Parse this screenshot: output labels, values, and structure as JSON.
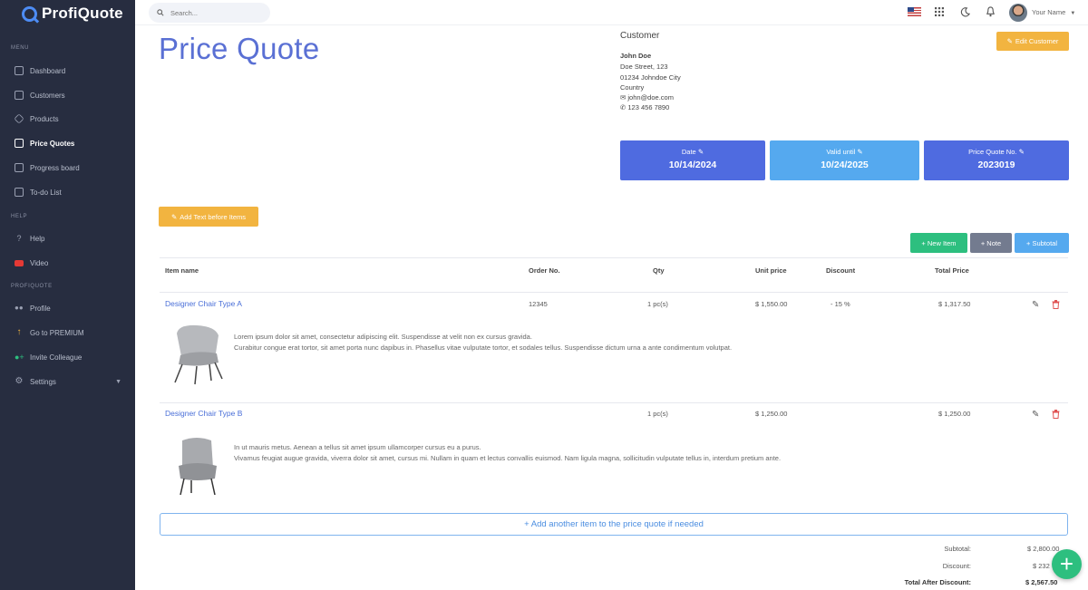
{
  "app": {
    "brand": "ProfiQuote"
  },
  "sidebar": {
    "headings": {
      "menu": "MENU",
      "help": "HELP",
      "profiquote": "PROFIQUOTE"
    },
    "items": [
      {
        "label": "Dashboard",
        "icon": "dashboard-icon"
      },
      {
        "label": "Customers",
        "icon": "customers-icon"
      },
      {
        "label": "Products",
        "icon": "products-icon"
      },
      {
        "label": "Price Quotes",
        "icon": "price-quotes-icon",
        "active": true
      },
      {
        "label": "Progress board",
        "icon": "progress-board-icon"
      },
      {
        "label": "To-do List",
        "icon": "todo-icon"
      },
      {
        "label": "Help",
        "icon": "help-icon"
      },
      {
        "label": "Video",
        "icon": "video-icon"
      },
      {
        "label": "Profile",
        "icon": "profile-icon"
      },
      {
        "label": "Go to PREMIUM",
        "icon": "arrow-up-icon"
      },
      {
        "label": "Invite Colleague",
        "icon": "add-user-icon"
      },
      {
        "label": "Settings",
        "icon": "settings-icon"
      }
    ]
  },
  "topbar": {
    "search_placeholder": "Search...",
    "username": "Your Name"
  },
  "quote": {
    "title": "Price Quote",
    "customer": {
      "heading": "Customer",
      "name": "John Doe",
      "street": "Doe Street, 123",
      "city": "01234 Johndoe City",
      "country": "Country",
      "email": "john@doe.com",
      "phone": "123 456 7890",
      "edit_label": "Edit Customer"
    },
    "date": {
      "label": "Date",
      "value": "10/14/2024"
    },
    "valid_until": {
      "label": "Valid until",
      "value": "10/24/2025"
    },
    "number": {
      "label": "Price Quote No.",
      "value": "2023019"
    },
    "add_text_label": "Add Text before Items",
    "buttons": {
      "new_item": "+ New Item",
      "note": "+ Note",
      "subtotal": "+ Subtotal"
    },
    "columns": {
      "item_name": "Item name",
      "order_no": "Order No.",
      "qty": "Qty",
      "unit_price": "Unit price",
      "discount": "Discount",
      "total_price": "Total Price"
    },
    "items": [
      {
        "name": "Designer Chair Type A",
        "order_no": "12345",
        "qty": "1 pc(s)",
        "unit_price": "$ 1,550.00",
        "discount": "- 15 %",
        "total": "$ 1,317.50",
        "desc1": "Lorem ipsum dolor sit amet, consectetur adipiscing elit. Suspendisse at velit non ex cursus gravida.",
        "desc2": "Curabitur congue erat tortor, sit amet porta nunc dapibus in. Phasellus vitae vulputate tortor, et sodales tellus. Suspendisse dictum urna a ante condimentum volutpat."
      },
      {
        "name": "Designer Chair Type B",
        "order_no": "",
        "qty": "1 pc(s)",
        "unit_price": "$ 1,250.00",
        "discount": "",
        "total": "$ 1,250.00",
        "desc1": "In ut mauris metus. Aenean a tellus sit amet ipsum ullamcorper cursus eu a purus.",
        "desc2": "Vivamus feugiat augue gravida, viverra dolor sit amet, cursus mi. Nullam in quam et lectus convallis euismod. Nam ligula magna, sollicitudin vulputate tellus in, interdum pretium ante."
      }
    ],
    "add_item_label": "+ Add another item to the price quote if needed",
    "summary": {
      "subtotal_label": "Subtotal:",
      "subtotal_value": "$ 2,800.00",
      "discount_label": "Discount:",
      "discount_value": "$ 232",
      "total_label": "Total After Discount:",
      "total_value": "$ 2,567.50"
    }
  },
  "colors": {
    "accent": "#5a70d4",
    "date_box": "#4f6be0",
    "valid_box": "#55a9ef",
    "number_box": "#4f6be0",
    "orange": "#f2b440",
    "green": "#2dbf7f"
  }
}
